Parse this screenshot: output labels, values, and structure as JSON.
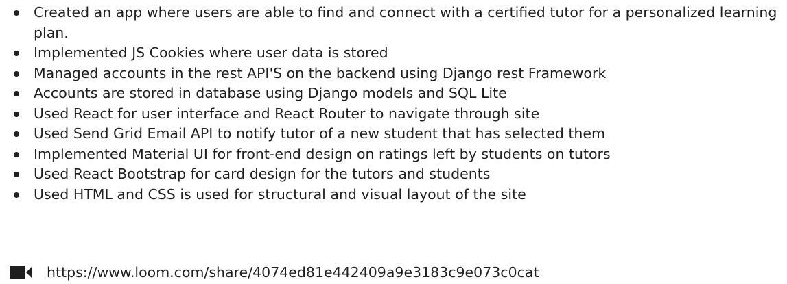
{
  "bullets": [
    "Created an app where users are able to find and connect with a certified tutor for a personalized learning plan.",
    "Implemented JS Cookies where user data is stored",
    "Managed accounts in the rest API'S on the backend using Django rest Framework",
    "Accounts are stored in database using Django models and SQL Lite",
    "Used React for user interface and React Router to navigate through site",
    "Used Send Grid Email API to notify tutor of a new student that has selected them",
    "Implemented Material UI for front-end design on ratings left by students on tutors",
    "Used React Bootstrap for card design for the tutors and students",
    "Used HTML and CSS is used for structural and visual layout of the site"
  ],
  "video_link": {
    "icon": "video-camera-icon",
    "url_text": "https://www.loom.com/share/4074ed81e442409a9e3183c9e073c0cat"
  },
  "colors": {
    "text": "#1f1f1f",
    "background": "#ffffff"
  }
}
